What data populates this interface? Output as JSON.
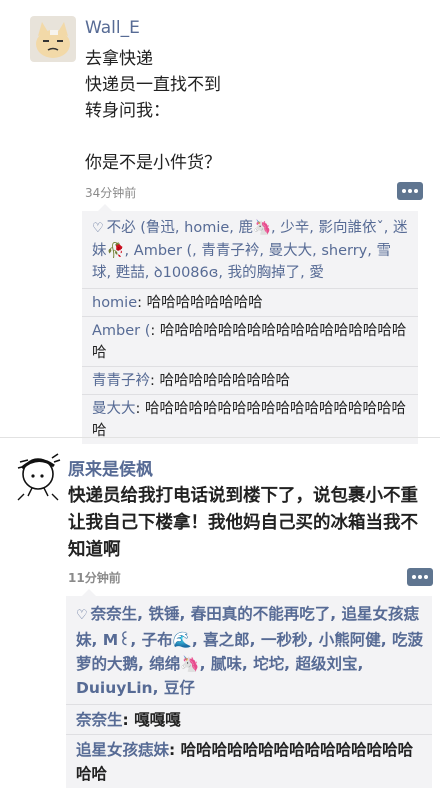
{
  "post1": {
    "username": "Wall_E",
    "content": "去拿快递\n快递员一直找不到\n转身问我：\n\n你是不是小件货？",
    "time": "34分钟前",
    "likes": "不必 (鲁迅, homie, 鹿🦄, 少辛, 影向誰依ˇ, 迷妹🥀, Amber (, 青青子衿, 曼大大, sherry, 雪球, 甦喆, ꝺ10086ɞ, 我的胸掉了, 愛",
    "comments": [
      {
        "name": "homie",
        "text": "哈哈哈哈哈哈哈哈"
      },
      {
        "name": "Amber (",
        "text": "哈哈哈哈哈哈哈哈哈哈哈哈哈哈哈哈哈哈"
      },
      {
        "name": "青青子衿",
        "text": "哈哈哈哈哈哈哈哈哈"
      },
      {
        "name": "曼大大",
        "text": "哈哈哈哈哈哈哈哈哈哈哈哈哈哈哈哈哈哈哈"
      }
    ]
  },
  "post2": {
    "username": "原来是侯枫",
    "content": "快递员给我打电话说到楼下了，说包裹小不重让我自己下楼拿！我他妈自己买的冰箱当我不知道啊",
    "time": "11分钟前",
    "likes": "奈奈生, 铁锤, 春田真的不能再吃了, 追星女孩痣妹, M꒰, 子布🌊, 喜之郎, 一秒秒, 小熊阿健, 吃菠萝的大鹅, 绵绵🦄, 腻味, 坨坨, 超级刘宝, DuiuyLin, 豆仔",
    "comments": [
      {
        "name": "奈奈生",
        "text": "嘎嘎嘎"
      },
      {
        "name": "追星女孩痣妹",
        "text": "哈哈哈哈哈哈哈哈哈哈哈哈哈哈哈哈哈"
      }
    ]
  },
  "colors": {
    "link": "#576b95",
    "social_bg": "#f3f3f5",
    "more_btn": "#5f7590"
  }
}
